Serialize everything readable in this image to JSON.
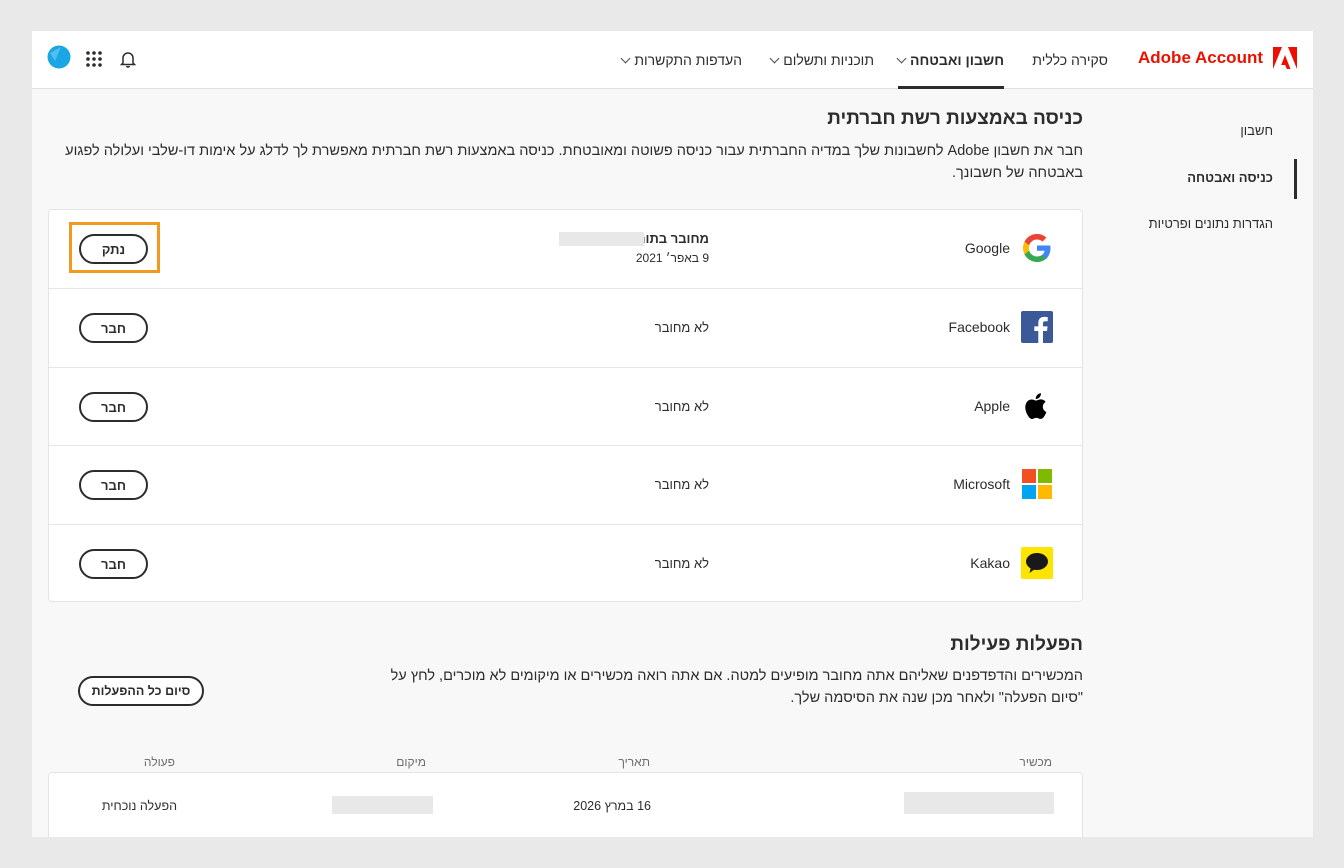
{
  "header": {
    "brand": "Adobe Account",
    "nav": [
      {
        "label": "סקירה כללית",
        "dropdown": false,
        "active": false
      },
      {
        "label": "חשבון ואבטחה",
        "dropdown": true,
        "active": true
      },
      {
        "label": "תוכניות ותשלום",
        "dropdown": true,
        "active": false
      },
      {
        "label": "העדפות התקשרות",
        "dropdown": true,
        "active": false
      }
    ],
    "icons": [
      "bell-icon",
      "apps-grid-icon",
      "avatar"
    ]
  },
  "sidebar": {
    "items": [
      {
        "label": "חשבון",
        "active": false
      },
      {
        "label": "כניסה ואבטחה",
        "active": true
      },
      {
        "label": "הגדרות נתונים ופרטיות",
        "active": false
      }
    ]
  },
  "social": {
    "title": "כניסה באמצעות רשת חברתית",
    "description": "חבר את חשבון Adobe לחשבונות שלך במדיה החברתית עבור כניסה פשוטה ומאובטחת. כניסה באמצעות רשת חברתית מאפשרת לך לדלג על אימות דו-שלבי ועלולה לפגוע באבטחה של חשבונך.",
    "providers": [
      {
        "name": "Google",
        "icon": "google-icon",
        "status": "מחובר בתור",
        "date": "9 באפר׳ 2021",
        "button": "נתק",
        "connected": true
      },
      {
        "name": "Facebook",
        "icon": "facebook-icon",
        "status": "לא מחובר",
        "button": "חבר",
        "connected": false
      },
      {
        "name": "Apple",
        "icon": "apple-icon",
        "status": "לא מחובר",
        "button": "חבר",
        "connected": false
      },
      {
        "name": "Microsoft",
        "icon": "microsoft-icon",
        "status": "לא מחובר",
        "button": "חבר",
        "connected": false
      },
      {
        "name": "Kakao",
        "icon": "kakao-icon",
        "status": "לא מחובר",
        "button": "חבר",
        "connected": false
      }
    ]
  },
  "sessions": {
    "title": "הפעלות פעילות",
    "description": "המכשירים והדפדפנים שאליהם אתה מחובר מופיעים למטה. אם אתה רואה מכשירים או מיקומים לא מוכרים, לחץ על \"סיום הפעלה\" ולאחר מכן שנה את הסיסמה שלך.",
    "end_all": "סיום כל ההפעלות",
    "columns": {
      "device": "מכשיר",
      "date": "תאריך",
      "location": "מיקום",
      "action": "פעולה"
    },
    "rows": [
      {
        "date": "16 במרץ 2026",
        "action": "הפעלה נוכחית"
      }
    ]
  },
  "colors": {
    "brand": "#eb1000",
    "highlight": "#f29a1f",
    "avatar": "#1aa6e4"
  }
}
